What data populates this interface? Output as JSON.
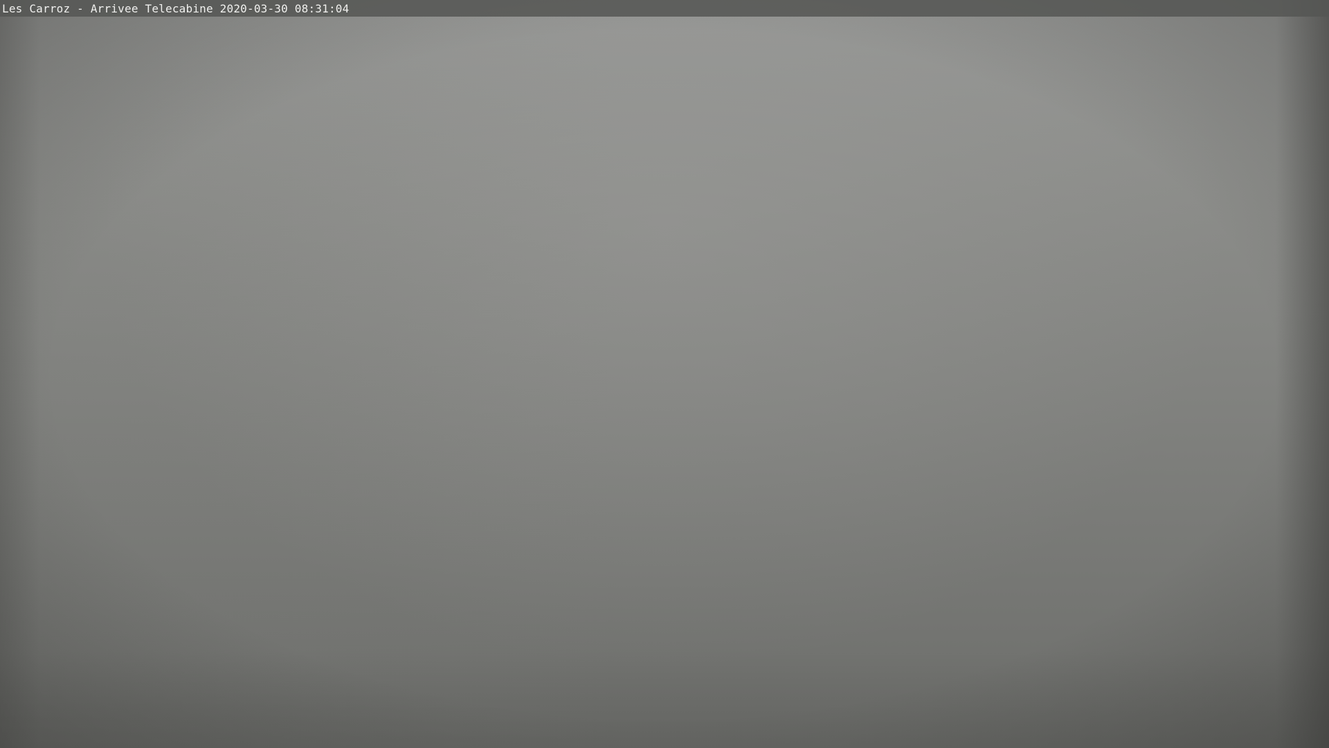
{
  "overlay": {
    "caption": "Les Carroz - Arrivee Telecabine 2020-03-30 08:31:04"
  },
  "colors": {
    "sky_top": "#959694",
    "sky_bottom": "#6c6d6a",
    "caption_bar": "#555654",
    "caption_text": "#f0f0ee"
  }
}
